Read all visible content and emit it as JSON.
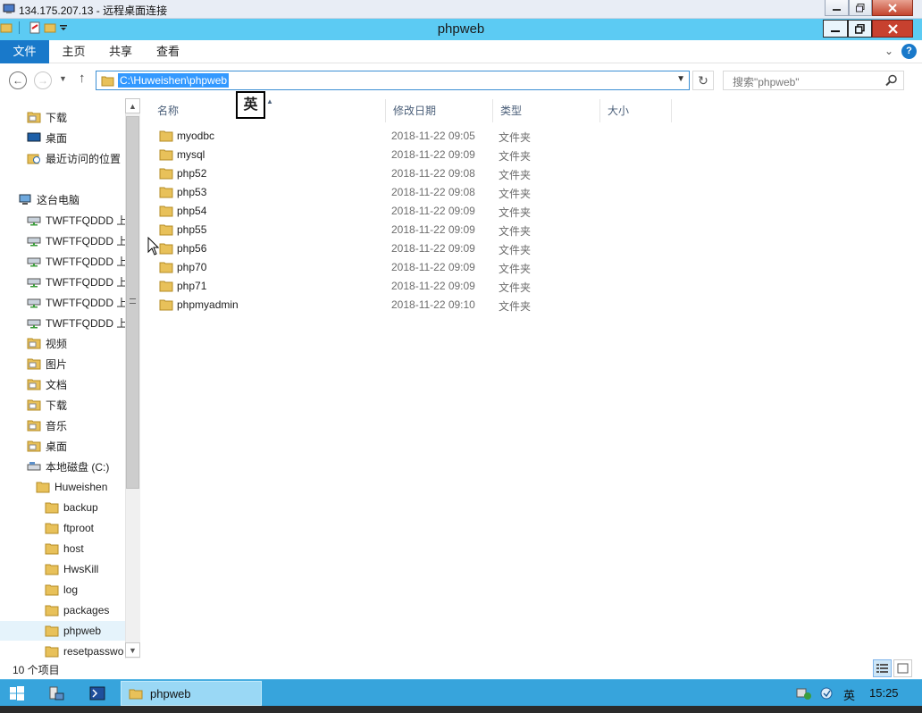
{
  "rdp": {
    "title": "134.175.207.13 - 远程桌面连接"
  },
  "window": {
    "title": "phpweb"
  },
  "ribbon": {
    "tabs": [
      "文件",
      "主页",
      "共享",
      "查看"
    ]
  },
  "address": {
    "path": "C:\\Huweishen\\phpweb"
  },
  "search": {
    "placeholder": "搜索\"phpweb\""
  },
  "ime_indicator": "英",
  "nav": {
    "items": [
      {
        "label": "下载",
        "icon": "download-folder-icon"
      },
      {
        "label": "桌面",
        "icon": "desktop-icon"
      },
      {
        "label": "最近访问的位置",
        "icon": "recent-places-icon"
      },
      {
        "label": "这台电脑",
        "icon": "computer-icon"
      },
      {
        "label": "TWFTFQDDD 上",
        "icon": "network-drive-icon"
      },
      {
        "label": "TWFTFQDDD 上",
        "icon": "network-drive-icon"
      },
      {
        "label": "TWFTFQDDD 上",
        "icon": "network-drive-icon"
      },
      {
        "label": "TWFTFQDDD 上",
        "icon": "network-drive-icon"
      },
      {
        "label": "TWFTFQDDD 上",
        "icon": "network-drive-icon"
      },
      {
        "label": "TWFTFQDDD 上",
        "icon": "network-drive-icon"
      },
      {
        "label": "视频",
        "icon": "videos-folder-icon"
      },
      {
        "label": "图片",
        "icon": "pictures-folder-icon"
      },
      {
        "label": "文档",
        "icon": "documents-folder-icon"
      },
      {
        "label": "下载",
        "icon": "download-folder-icon"
      },
      {
        "label": "音乐",
        "icon": "music-folder-icon"
      },
      {
        "label": "桌面",
        "icon": "desktop-folder-icon"
      },
      {
        "label": "本地磁盘 (C:)",
        "icon": "local-disk-icon"
      },
      {
        "label": "Huweishen",
        "icon": "folder-icon"
      },
      {
        "label": "backup",
        "icon": "folder-icon"
      },
      {
        "label": "ftproot",
        "icon": "folder-icon"
      },
      {
        "label": "host",
        "icon": "folder-icon"
      },
      {
        "label": "HwsKill",
        "icon": "folder-icon"
      },
      {
        "label": "log",
        "icon": "folder-icon"
      },
      {
        "label": "packages",
        "icon": "folder-icon"
      },
      {
        "label": "phpweb",
        "icon": "folder-icon"
      },
      {
        "label": "resetpasswo",
        "icon": "folder-icon"
      }
    ]
  },
  "columns": [
    "名称",
    "修改日期",
    "类型",
    "大小"
  ],
  "files": [
    {
      "name": "myodbc",
      "date": "2018-11-22 09:05",
      "type": "文件夹"
    },
    {
      "name": "mysql",
      "date": "2018-11-22 09:09",
      "type": "文件夹"
    },
    {
      "name": "php52",
      "date": "2018-11-22 09:08",
      "type": "文件夹"
    },
    {
      "name": "php53",
      "date": "2018-11-22 09:08",
      "type": "文件夹"
    },
    {
      "name": "php54",
      "date": "2018-11-22 09:09",
      "type": "文件夹"
    },
    {
      "name": "php55",
      "date": "2018-11-22 09:09",
      "type": "文件夹"
    },
    {
      "name": "php56",
      "date": "2018-11-22 09:09",
      "type": "文件夹"
    },
    {
      "name": "php70",
      "date": "2018-11-22 09:09",
      "type": "文件夹"
    },
    {
      "name": "php71",
      "date": "2018-11-22 09:09",
      "type": "文件夹"
    },
    {
      "name": "phpmyadmin",
      "date": "2018-11-22 09:10",
      "type": "文件夹"
    }
  ],
  "status": {
    "item_count": "10 个项目"
  },
  "taskbar": {
    "task_label": "phpweb",
    "ime": "英",
    "clock": "15:25"
  },
  "colors": {
    "title_bar": "#5ccbf3",
    "file_tab": "#1979ca",
    "taskbar": "#37a4dc",
    "folder": "#e8c15a"
  }
}
